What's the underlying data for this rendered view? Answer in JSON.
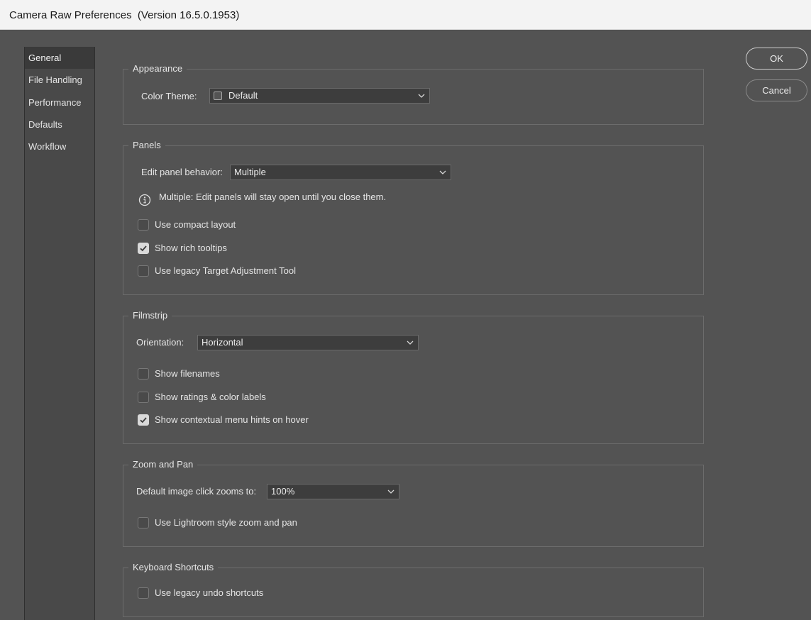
{
  "window": {
    "title": "Camera Raw Preferences  (Version 16.5.0.1953)"
  },
  "sidebar": {
    "items": [
      {
        "label": "General",
        "active": true
      },
      {
        "label": "File Handling",
        "active": false
      },
      {
        "label": "Performance",
        "active": false
      },
      {
        "label": "Defaults",
        "active": false
      },
      {
        "label": "Workflow",
        "active": false
      }
    ]
  },
  "buttons": {
    "ok": "OK",
    "cancel": "Cancel"
  },
  "appearance": {
    "legend": "Appearance",
    "color_theme_label": "Color Theme:",
    "color_theme_value": "Default"
  },
  "panels": {
    "legend": "Panels",
    "edit_behavior_label": "Edit panel behavior:",
    "edit_behavior_value": "Multiple",
    "info_text": "Multiple: Edit panels will stay open until you close them.",
    "compact_layout": {
      "label": "Use compact layout",
      "checked": false
    },
    "rich_tooltips": {
      "label": "Show rich tooltips",
      "checked": true
    },
    "legacy_tat": {
      "label": "Use legacy Target Adjustment Tool",
      "checked": false
    }
  },
  "filmstrip": {
    "legend": "Filmstrip",
    "orientation_label": "Orientation:",
    "orientation_value": "Horizontal",
    "show_filenames": {
      "label": "Show filenames",
      "checked": false
    },
    "show_ratings": {
      "label": "Show ratings & color labels",
      "checked": false
    },
    "context_hints": {
      "label": "Show contextual menu hints on hover",
      "checked": true
    }
  },
  "zoom": {
    "legend": "Zoom and Pan",
    "default_zoom_label": "Default image click zooms to:",
    "default_zoom_value": "100%",
    "lightroom_style": {
      "label": "Use Lightroom style zoom and pan",
      "checked": false
    }
  },
  "keyboard": {
    "legend": "Keyboard Shortcuts",
    "legacy_undo": {
      "label": "Use legacy undo shortcuts",
      "checked": false
    }
  }
}
